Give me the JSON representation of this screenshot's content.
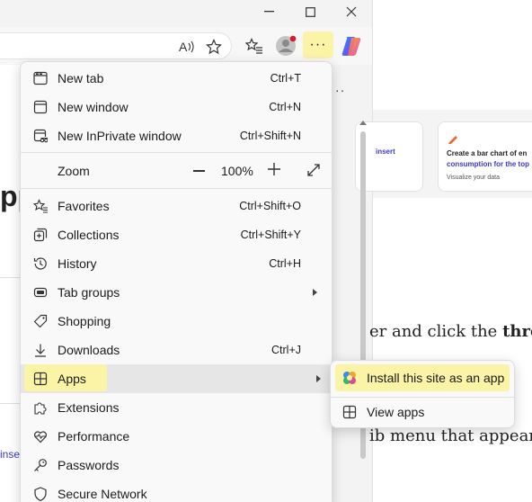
{
  "window": {
    "minimize_icon": "minimize-icon",
    "maximize_icon": "maximize-icon",
    "close_icon": "close-icon"
  },
  "toolbar": {
    "read_aloud_icon": "read-aloud-icon",
    "favorite_icon": "favorite-star-icon",
    "favorites_bar_icon": "favorites-icon",
    "profile_icon": "profile-icon",
    "more_label": "···",
    "copilot_icon": "copilot-icon"
  },
  "background_page": {
    "big_heading_fragment": "pp",
    "side_link_fragment": "inse",
    "card_insert_fragment": "insert",
    "card_title_line1": "Create a bar chart of en",
    "card_title_line2": "consumption for the top",
    "card_subtitle": "Visualize your data",
    "para_line1_plain": "er and click the ",
    "para_line1_bold": "thre",
    "para_line2": "ib menu that appear",
    "tab_more": "··"
  },
  "menu": {
    "items": [
      {
        "label": "New tab",
        "shortcut": "Ctrl+T",
        "icon": "new-tab-icon"
      },
      {
        "label": "New window",
        "shortcut": "Ctrl+N",
        "icon": "new-window-icon"
      },
      {
        "label": "New InPrivate window",
        "shortcut": "Ctrl+Shift+N",
        "icon": "inprivate-icon"
      },
      {
        "label": "Favorites",
        "shortcut": "Ctrl+Shift+O",
        "icon": "favorites-icon"
      },
      {
        "label": "Collections",
        "shortcut": "Ctrl+Shift+Y",
        "icon": "collections-icon"
      },
      {
        "label": "History",
        "shortcut": "Ctrl+H",
        "icon": "history-icon"
      },
      {
        "label": "Tab groups",
        "shortcut": "",
        "icon": "tab-groups-icon"
      },
      {
        "label": "Shopping",
        "shortcut": "",
        "icon": "shopping-tag-icon"
      },
      {
        "label": "Downloads",
        "shortcut": "Ctrl+J",
        "icon": "download-icon"
      },
      {
        "label": "Apps",
        "shortcut": "",
        "icon": "apps-icon"
      },
      {
        "label": "Extensions",
        "shortcut": "",
        "icon": "extensions-icon"
      },
      {
        "label": "Performance",
        "shortcut": "",
        "icon": "performance-icon"
      },
      {
        "label": "Passwords",
        "shortcut": "",
        "icon": "key-icon"
      },
      {
        "label": "Secure Network",
        "shortcut": "",
        "icon": "shield-icon"
      }
    ],
    "zoom": {
      "label": "Zoom",
      "value": "100%",
      "minus": "−",
      "plus": "+"
    }
  },
  "submenu": {
    "items": [
      {
        "label": "Install this site as an app",
        "icon": "install-app-icon"
      },
      {
        "label": "View apps",
        "icon": "view-apps-icon"
      }
    ]
  },
  "colors": {
    "highlight": "#fbf3a5",
    "menu_bg": "#f9f9f9",
    "link_blue": "#3a3ad1"
  }
}
